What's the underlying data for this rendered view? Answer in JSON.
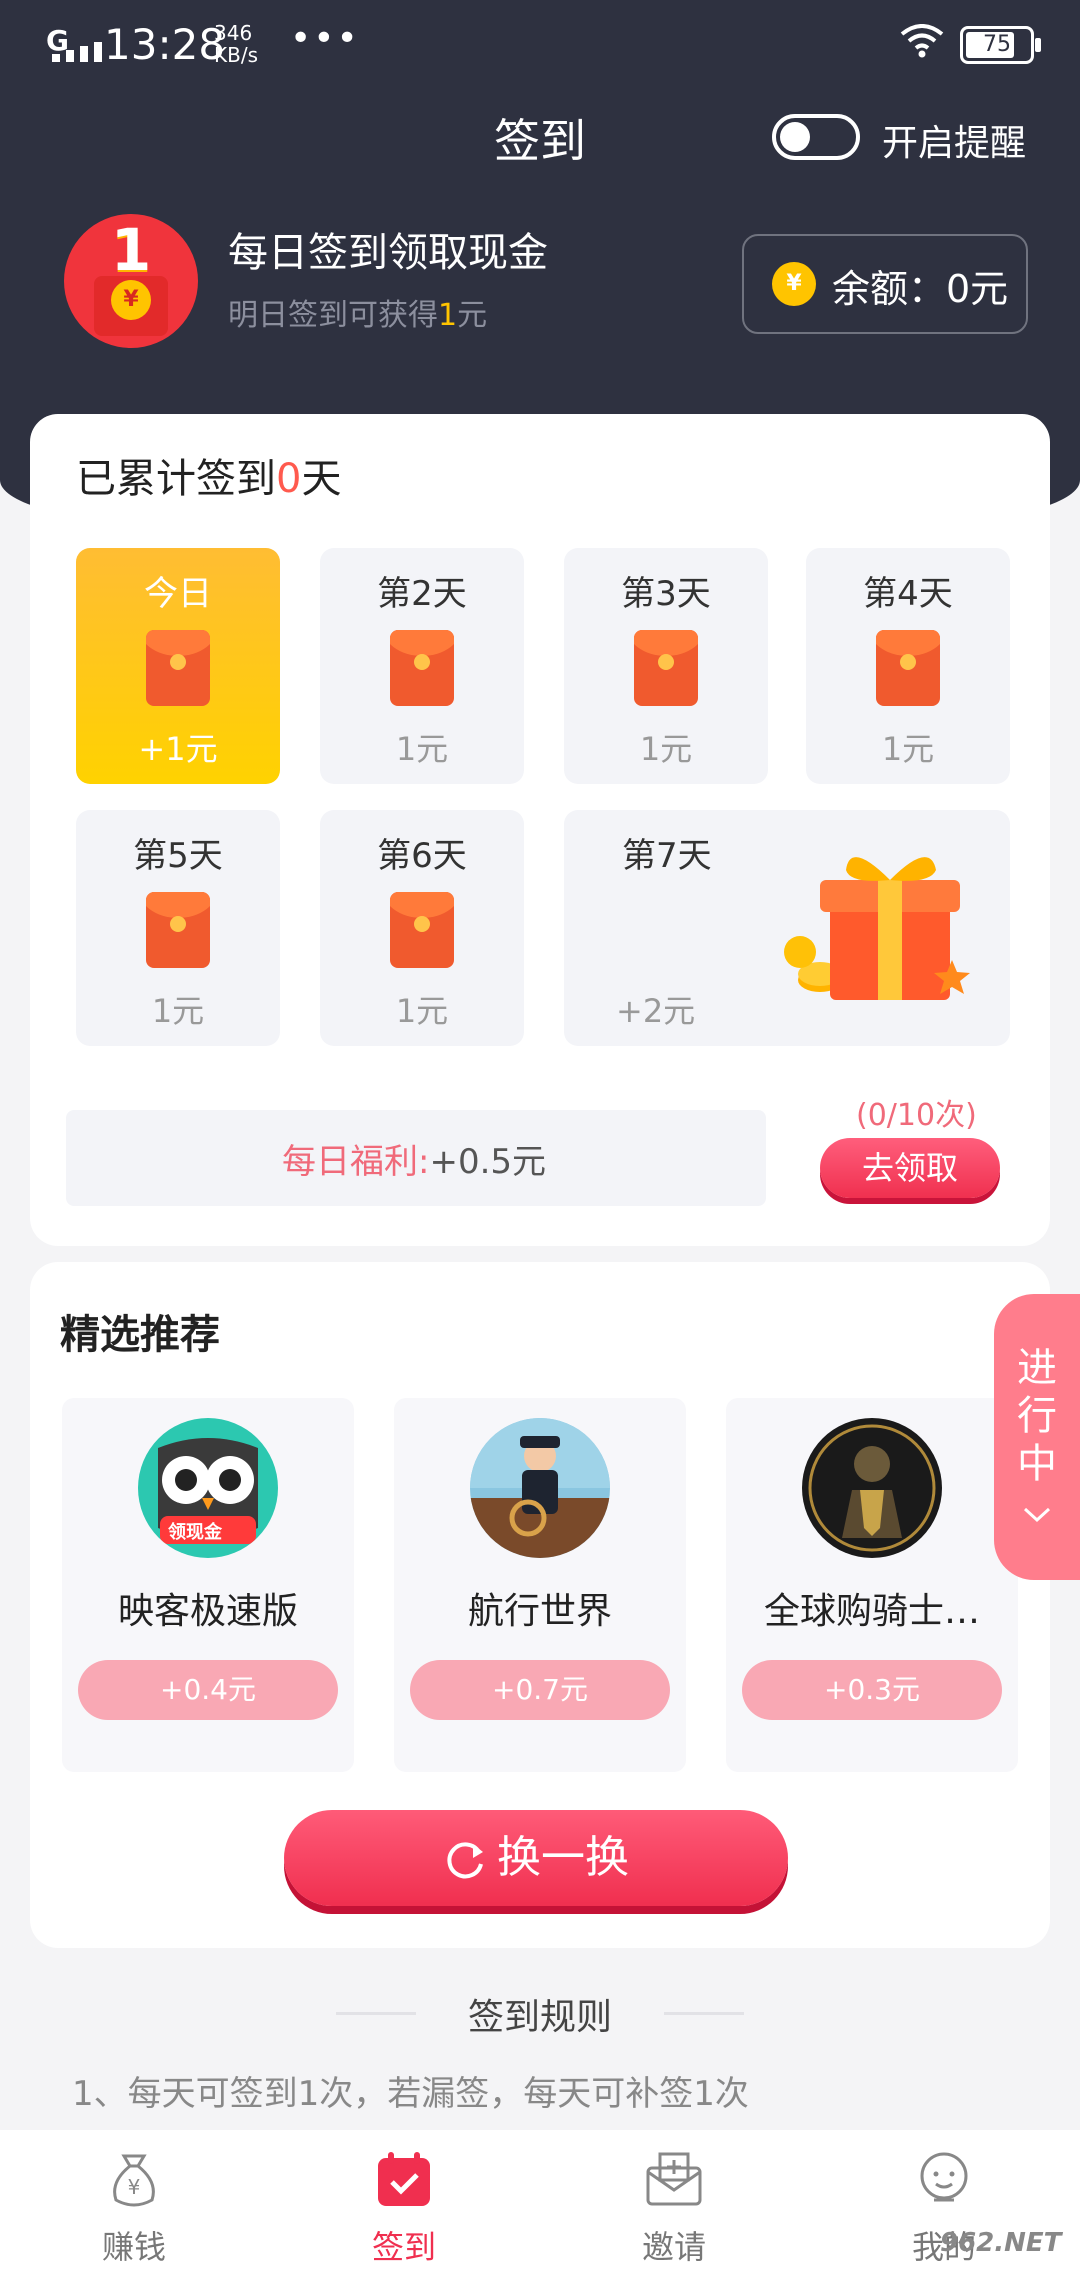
{
  "status_bar": {
    "network": "G",
    "time": "13:28",
    "speed_value": "346",
    "speed_unit": "KB/s",
    "more": "•••",
    "battery": "75"
  },
  "header": {
    "title": "签到",
    "reminder_label": "开启提醒",
    "reminder_on": false,
    "badge_number": "1",
    "headline": "每日签到领取现金",
    "subline_prefix": "明日签到可获得",
    "subline_amount": "1",
    "subline_suffix": "元",
    "balance": "余额：0元"
  },
  "signin": {
    "cum_prefix": "已累计签到",
    "cum_days": "0",
    "cum_suffix": "天",
    "days": [
      {
        "label": "今日",
        "value": "+1元"
      },
      {
        "label": "第2天",
        "value": "1元"
      },
      {
        "label": "第3天",
        "value": "1元"
      },
      {
        "label": "第4天",
        "value": "1元"
      },
      {
        "label": "第5天",
        "value": "1元"
      },
      {
        "label": "第6天",
        "value": "1元"
      },
      {
        "label": "第7天",
        "value": "+2元"
      }
    ],
    "welfare_label": "每日福利:",
    "welfare_value": "+0.5元",
    "claim_count": "(0/10次)",
    "claim_button": "去领取"
  },
  "recommend": {
    "title": "精选推荐",
    "apps": [
      {
        "name": "映客极速版",
        "reward": "+0.4元",
        "badge": "领现金"
      },
      {
        "name": "航行世界",
        "reward": "+0.7元"
      },
      {
        "name": "全球购骑士…",
        "reward": "+0.3元"
      }
    ],
    "swap_button": "换一换",
    "in_progress": "进行中"
  },
  "rules": {
    "title": "签到规则",
    "line1": "1、每天可签到1次，若漏签，每天可补签1次"
  },
  "tabbar": {
    "items": [
      {
        "label": "赚钱"
      },
      {
        "label": "签到"
      },
      {
        "label": "邀请"
      },
      {
        "label": "我的"
      }
    ]
  },
  "watermark": "962.NET",
  "colors": {
    "header_bg": "#2e3140",
    "accent_red": "#f02f4f",
    "today_yellow": "#ffc400",
    "reward_pink": "#f9a8b4"
  }
}
